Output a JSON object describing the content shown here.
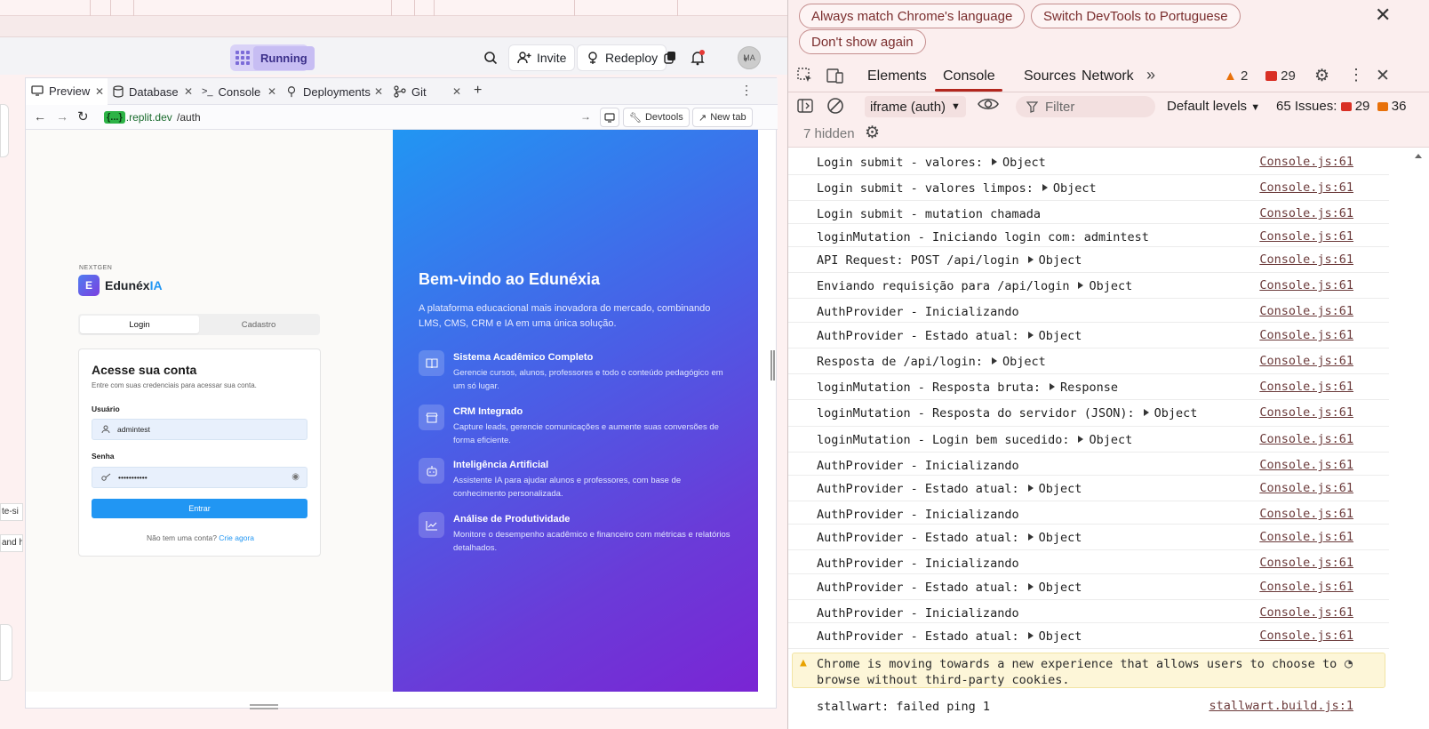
{
  "workspace": {
    "status_label": "Running",
    "invite_label": "Invite",
    "redeploy_label": "Redeploy",
    "avatar_initials": "MA",
    "tabs": [
      {
        "label": "Preview",
        "icon": "monitor-icon"
      },
      {
        "label": "Database",
        "icon": "database-icon"
      },
      {
        "label": "Console",
        "icon": "terminal-icon"
      },
      {
        "label": "Deployments",
        "icon": "deploy-icon"
      },
      {
        "label": "Git",
        "icon": "git-icon"
      }
    ],
    "url_badge": "{...}",
    "url_domain": ".replit.dev",
    "url_path": "/auth",
    "devtools_btn": "Devtools",
    "newtab_btn": "New tab",
    "left_fragments": [
      "te-si",
      "and h"
    ]
  },
  "login_page": {
    "brand_tag": "NEXTGEN",
    "brand_letter": "E",
    "brand_name": "Edunéx",
    "brand_suffix": "IA",
    "tab_login": "Login",
    "tab_signup": "Cadastro",
    "card_title": "Acesse sua conta",
    "card_subtitle": "Entre com suas credenciais para acessar sua conta.",
    "user_label": "Usuário",
    "user_value": "admintest",
    "password_label": "Senha",
    "password_value": "•••••••••••",
    "submit_label": "Entrar",
    "signup_prompt": "Não tem uma conta?",
    "signup_link": "Crie agora",
    "hero_title": "Bem-vindo ao Edunéxia",
    "hero_subtitle": "A plataforma educacional mais inovadora do mercado, combinando LMS, CMS, CRM e IA em uma única solução.",
    "features": [
      {
        "title": "Sistema Acadêmico Completo",
        "desc": "Gerencie cursos, alunos, professores e todo o conteúdo pedagógico em um só lugar.",
        "icon": "book-icon"
      },
      {
        "title": "CRM Integrado",
        "desc": "Capture leads, gerencie comunicações e aumente suas conversões de forma eficiente.",
        "icon": "store-icon"
      },
      {
        "title": "Inteligência Artificial",
        "desc": "Assistente IA para ajudar alunos e professores, com base de conhecimento personalizada.",
        "icon": "robot-icon"
      },
      {
        "title": "Análise de Produtividade",
        "desc": "Monitore o desempenho acadêmico e financeiro com métricas e relatórios detalhados.",
        "icon": "chart-icon"
      }
    ]
  },
  "devtools": {
    "banner_language": "Always match Chrome's language",
    "banner_switch": "Switch DevTools to Portuguese",
    "banner_dismiss": "Don't show again",
    "tabs": [
      "Elements",
      "Console",
      "Sources",
      "Network"
    ],
    "warn_count": "2",
    "error_count": "29",
    "context": "iframe (auth)",
    "filter_placeholder": "Filter",
    "levels": "Default levels",
    "issues_label": "65 Issues:",
    "issues_errors": "29",
    "issues_other": "36",
    "hidden_label": "7 hidden",
    "logs": [
      {
        "text": "Login submit - valores:",
        "obj": "Object",
        "src": "Console.js:61"
      },
      {
        "text": "Login submit - valores limpos:",
        "obj": "Object",
        "src": "Console.js:61"
      },
      {
        "text": "Login submit - mutation chamada",
        "obj": "",
        "src": "Console.js:61"
      },
      {
        "text": "loginMutation - Iniciando login com: admintest",
        "obj": "",
        "src": "Console.js:61"
      },
      {
        "text": "API Request: POST /api/login",
        "obj": "Object",
        "src": "Console.js:61"
      },
      {
        "text": "Enviando requisição para /api/login",
        "obj": "Object",
        "src": "Console.js:61"
      },
      {
        "text": "AuthProvider - Inicializando",
        "obj": "",
        "src": "Console.js:61"
      },
      {
        "text": "AuthProvider - Estado atual:",
        "obj": "Object",
        "src": "Console.js:61"
      },
      {
        "text": "Resposta de /api/login:",
        "obj": "Object",
        "src": "Console.js:61"
      },
      {
        "text": "loginMutation - Resposta bruta:",
        "obj": "Response",
        "src": "Console.js:61"
      },
      {
        "text": "loginMutation - Resposta do servidor (JSON):",
        "obj": "Object",
        "src": "Console.js:61"
      },
      {
        "text": "loginMutation - Login bem sucedido:",
        "obj": "Object",
        "src": "Console.js:61"
      },
      {
        "text": "AuthProvider - Inicializando",
        "obj": "",
        "src": "Console.js:61"
      },
      {
        "text": "AuthProvider - Estado atual:",
        "obj": "Object",
        "src": "Console.js:61"
      },
      {
        "text": "AuthProvider - Inicializando",
        "obj": "",
        "src": "Console.js:61"
      },
      {
        "text": "AuthProvider - Estado atual:",
        "obj": "Object",
        "src": "Console.js:61"
      },
      {
        "text": "AuthProvider - Inicializando",
        "obj": "",
        "src": "Console.js:61"
      },
      {
        "text": "AuthProvider - Estado atual:",
        "obj": "Object",
        "src": "Console.js:61"
      },
      {
        "text": "AuthProvider - Inicializando",
        "obj": "",
        "src": "Console.js:61"
      },
      {
        "text": "AuthProvider - Estado atual:",
        "obj": "Object",
        "src": "Console.js:61"
      }
    ],
    "warning": "Chrome is moving towards a new experience that allows users to choose to browse without third-party cookies.",
    "last_log": {
      "text": "stallwart: failed ping 1",
      "src": "stallwart.build.js:1"
    }
  },
  "colors": {
    "accent": "#2196f3",
    "devtools_active": "#b3261e",
    "running_bg": "#d9d2f7"
  }
}
